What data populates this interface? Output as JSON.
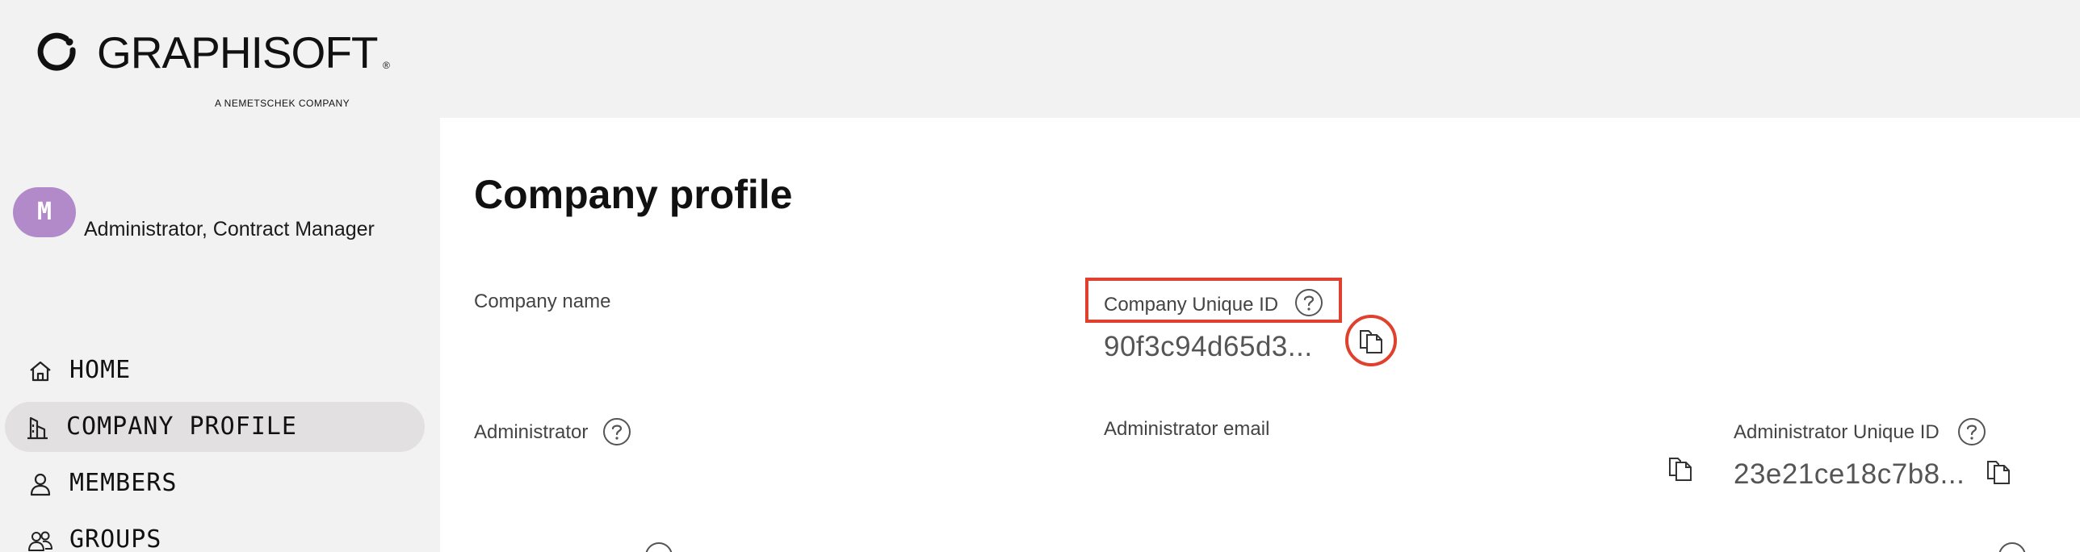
{
  "brand": {
    "name": "GRAPHISOFT",
    "registered": "®",
    "tagline": "A NEMETSCHEK COMPANY"
  },
  "user": {
    "avatar_initial": "M",
    "role": "Administrator, Contract Manager"
  },
  "nav": {
    "items": [
      {
        "label": "HOME",
        "icon": "home-icon"
      },
      {
        "label": "COMPANY PROFILE",
        "icon": "building-icon",
        "active": true
      },
      {
        "label": "MEMBERS",
        "icon": "person-icon"
      },
      {
        "label": "GROUPS",
        "icon": "people-icon"
      }
    ]
  },
  "main": {
    "title": "Company profile",
    "company_name_label": "Company name",
    "company_uid_label": "Company Unique ID",
    "company_uid_value": "90f3c94d65d3...",
    "administrator_label": "Administrator",
    "administrator_email_label": "Administrator email",
    "administrator_uid_label": "Administrator Unique ID",
    "administrator_uid_value": "23e21ce18c7b8..."
  },
  "colors": {
    "accent_avatar": "#b38ac9",
    "highlight": "#e0412f",
    "active_nav": "#e2e0e0"
  }
}
